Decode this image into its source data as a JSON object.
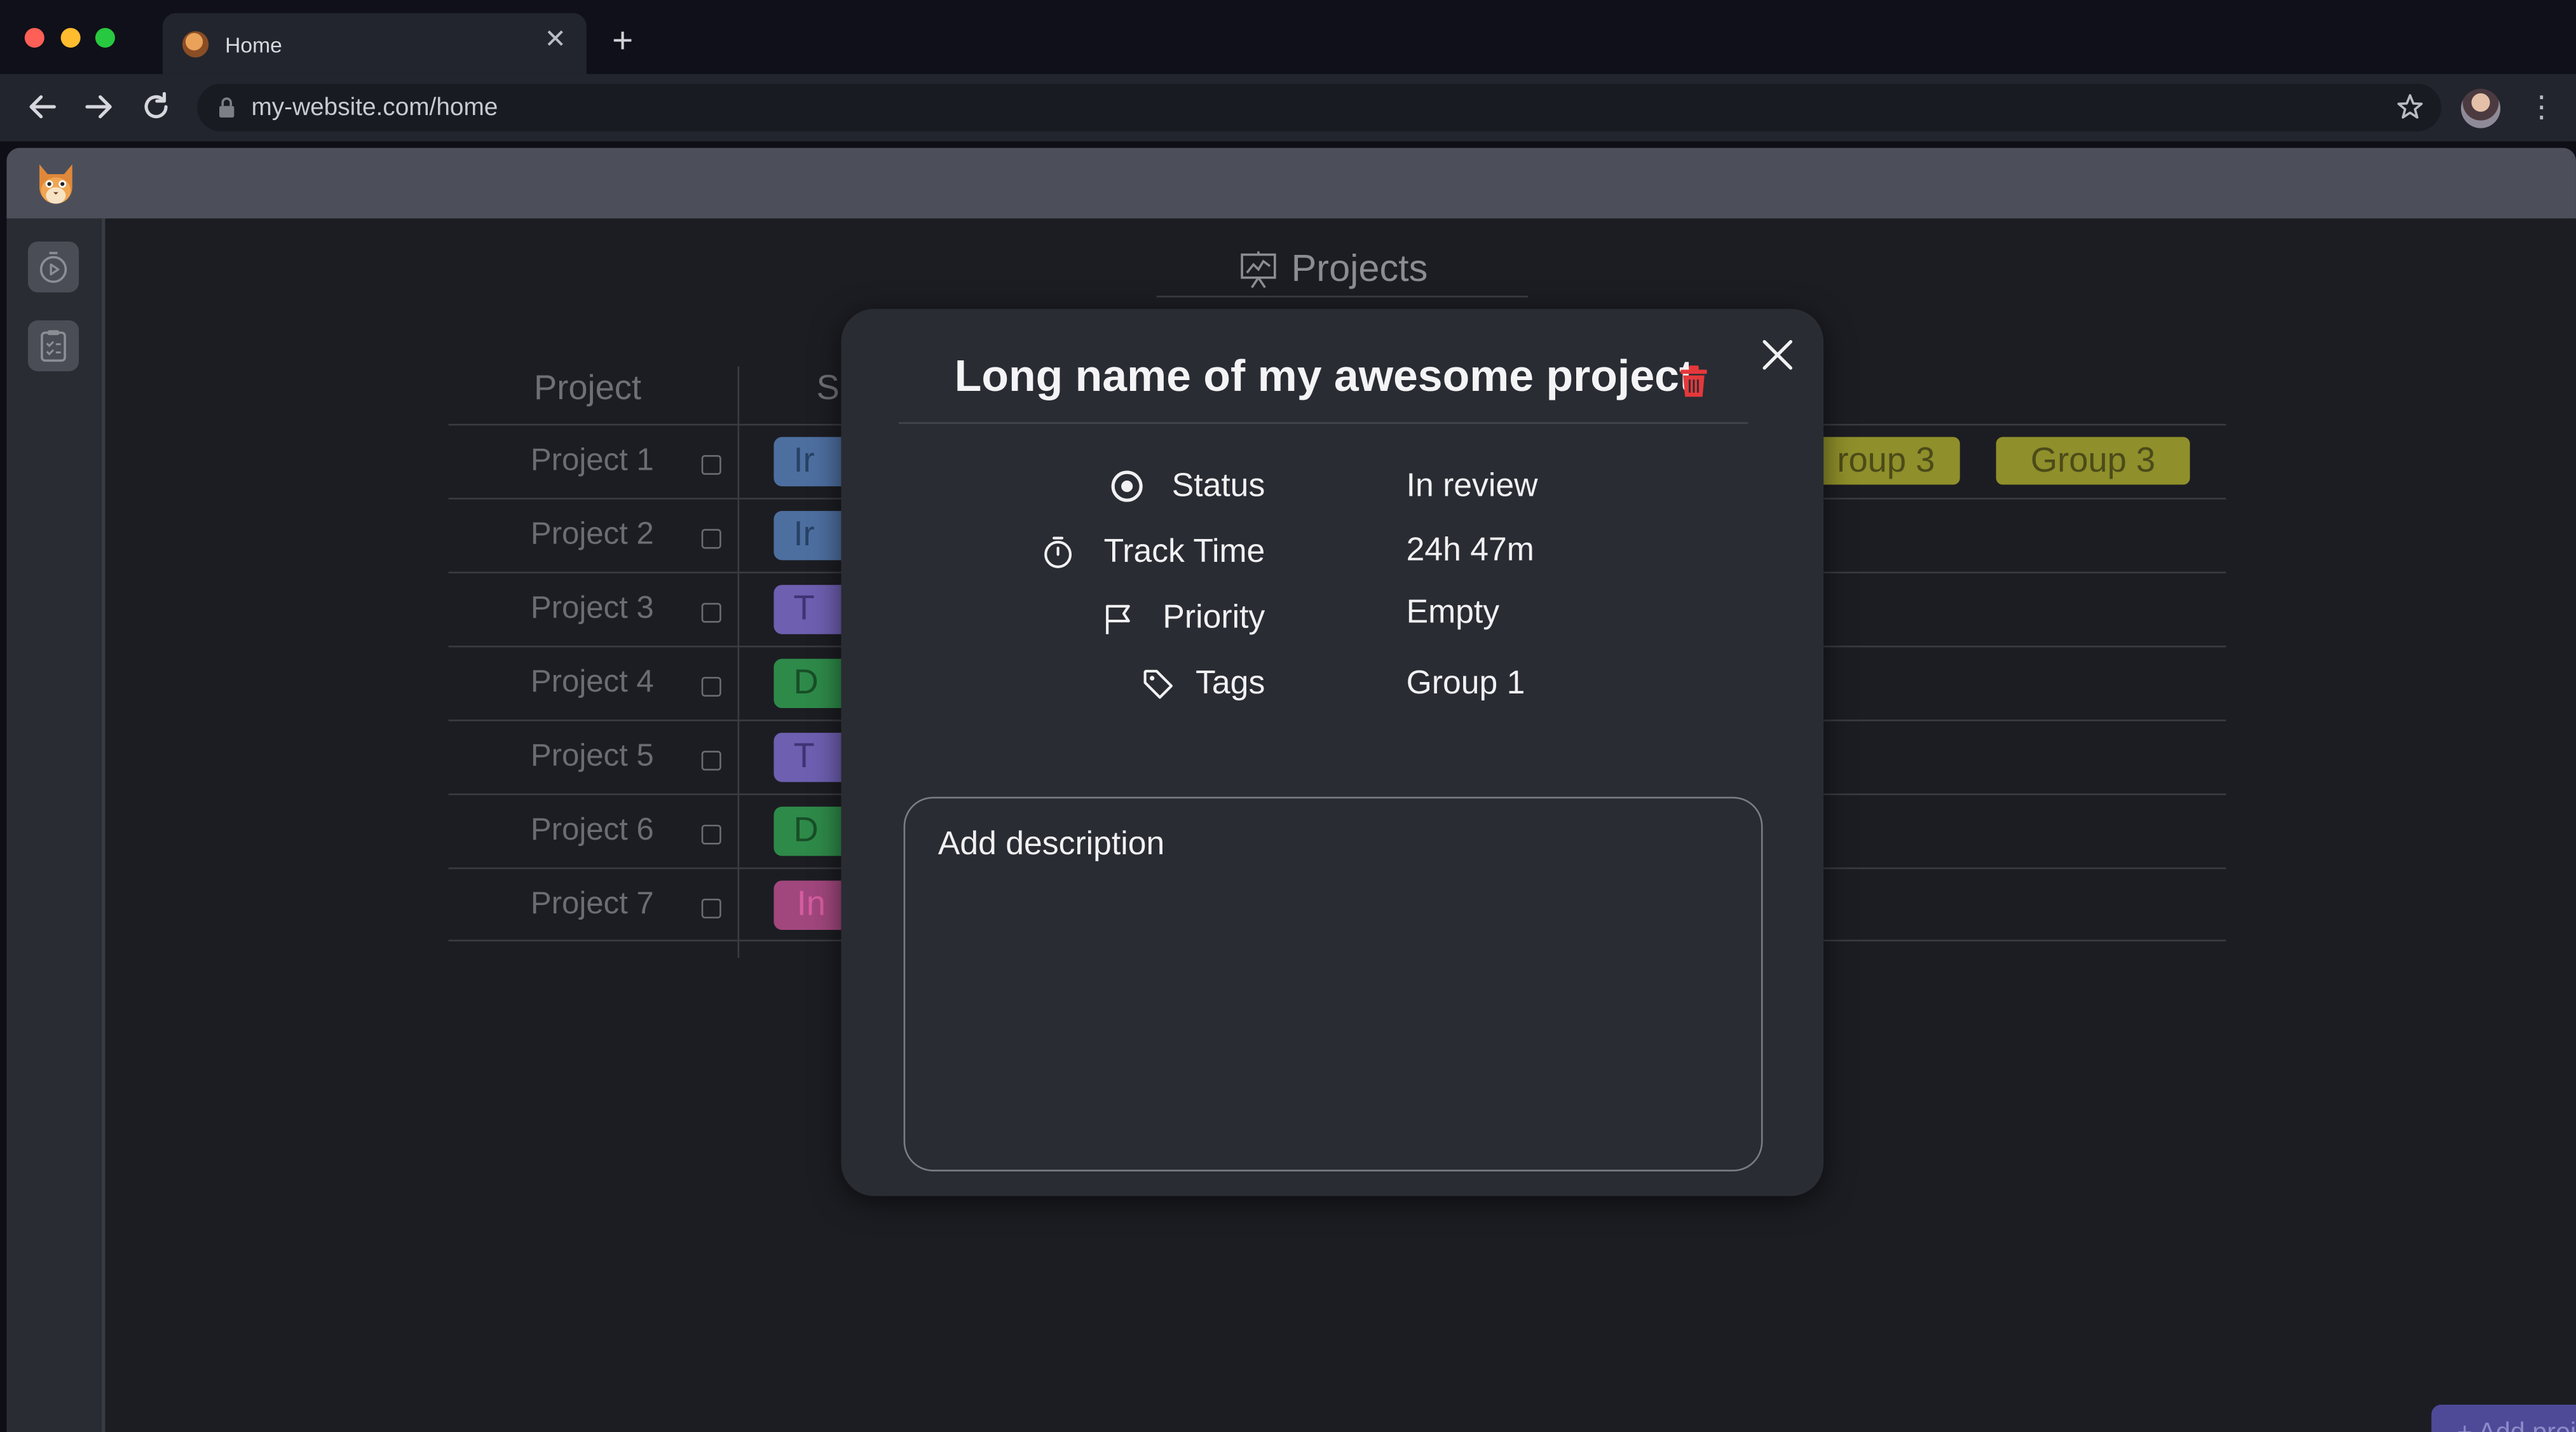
{
  "browser": {
    "tab_title": "Home",
    "tab_close_glyph": "✕",
    "new_tab_glyph": "+",
    "url": "my-website.com/home",
    "menu_glyph": "⋮"
  },
  "app": {
    "page_title": "Projects",
    "add_project_label": "+ Add project"
  },
  "table": {
    "headers": {
      "project": "Project",
      "status": "S"
    },
    "rows": [
      {
        "name": "Project 1",
        "status": "In review",
        "status_visible": "Ir",
        "status_color": "#4d6fa0",
        "status_text_color": "#284266"
      },
      {
        "name": "Project 2",
        "status": "In review",
        "status_visible": "Ir",
        "status_color": "#4d6fa0",
        "status_text_color": "#284266"
      },
      {
        "name": "Project 3",
        "status": "T",
        "status_visible": "T",
        "status_color": "#6e5fb1",
        "status_text_color": "#3e3473"
      },
      {
        "name": "Project 4",
        "status": "D",
        "status_visible": "D",
        "status_color": "#2e8a49",
        "status_text_color": "#184f28"
      },
      {
        "name": "Project 5",
        "status": "T",
        "status_visible": "T",
        "status_color": "#6e5fb1",
        "status_text_color": "#3e3473"
      },
      {
        "name": "Project 6",
        "status": "D",
        "status_visible": "D",
        "status_color": "#2e8a49",
        "status_text_color": "#184f28"
      },
      {
        "name": "Project 7",
        "status": "In",
        "status_visible": "In",
        "status_color": "#a1477e",
        "status_text_color": "#d65d9f"
      }
    ],
    "row1_tags": [
      "roup 3",
      "Group 3"
    ]
  },
  "modal": {
    "title": "Long name of my awesome project",
    "properties": [
      {
        "label": "Status",
        "value": "In review",
        "icon": "target-icon"
      },
      {
        "label": "Track Time",
        "value": "24h 47m",
        "icon": "stopwatch-icon"
      },
      {
        "label": "Priority",
        "value": "Empty",
        "icon": "flag-icon"
      },
      {
        "label": "Tags",
        "value": "Group 1",
        "icon": "tag-icon"
      }
    ],
    "description_placeholder": "Add description"
  },
  "colors": {
    "accent": "#4e4a98",
    "delete": "#e5383b",
    "tag_yellow": "#8f8f2b"
  }
}
